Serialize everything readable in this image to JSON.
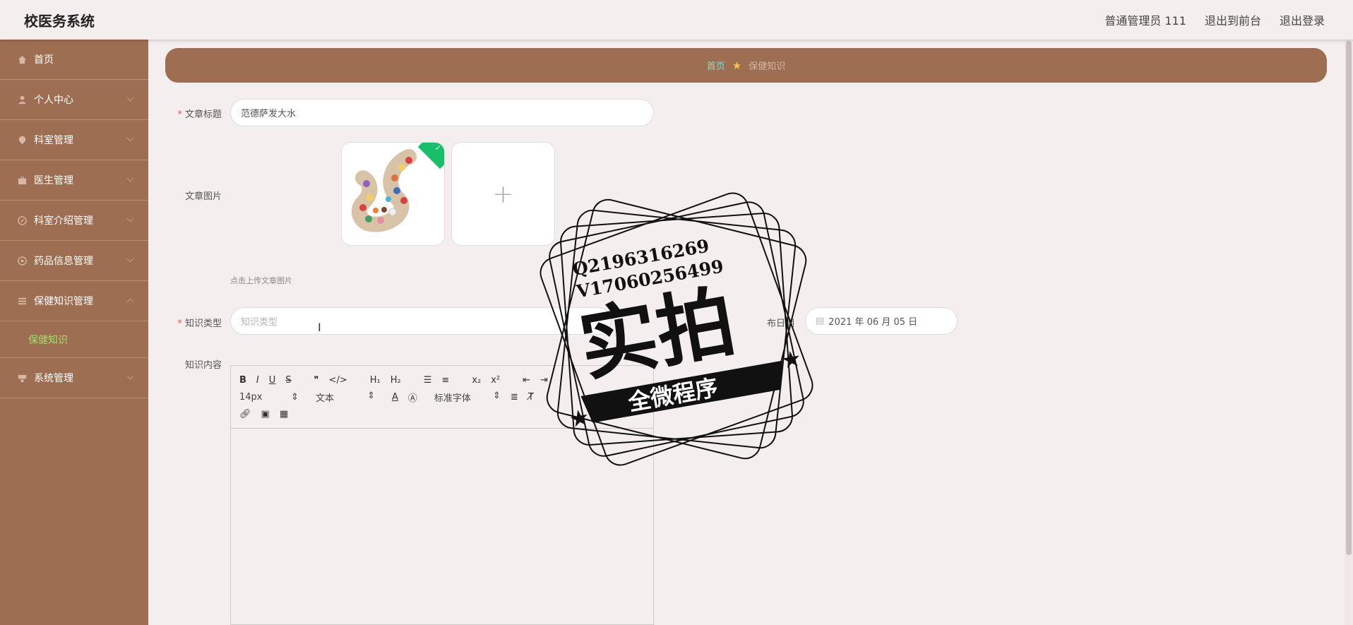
{
  "app": {
    "title": "校医务系统"
  },
  "header": {
    "user": "普通管理员 111",
    "exit_front": "退出到前台",
    "logout": "退出登录"
  },
  "sidebar": {
    "items": [
      {
        "label": "首页",
        "icon": "home-icon"
      },
      {
        "label": "个人中心",
        "icon": "user-icon"
      },
      {
        "label": "科室管理",
        "icon": "location-icon"
      },
      {
        "label": "医生管理",
        "icon": "briefcase-icon"
      },
      {
        "label": "科室介绍管理",
        "icon": "compass-icon"
      },
      {
        "label": "药品信息管理",
        "icon": "pills-icon"
      },
      {
        "label": "保健知识管理",
        "icon": "menu-icon"
      },
      {
        "label": "系统管理",
        "icon": "settings-icon"
      }
    ],
    "sub_item": "保健知识"
  },
  "breadcrumb": {
    "home": "首页",
    "current": "保健知识"
  },
  "form": {
    "title_label": "文章标题",
    "title_value": "范德萨发大水",
    "image_label": "文章图片",
    "image_hint": "点击上传文章图片",
    "type_label": "知识类型",
    "type_placeholder": "知识类型",
    "date_label": "布日期",
    "date_value": "2021 年 06 月 05 日",
    "content_label": "知识内容"
  },
  "editor": {
    "font_size": "14px",
    "header_select": "文本",
    "font_family": "标准字体"
  },
  "watermark": {
    "line1": "Q2196316269",
    "line2": "V17060256499",
    "big": "实拍",
    "ribbon": "全微程序"
  },
  "colors": {
    "sidebar": "#9e6e52",
    "accent_green": "#9be36a",
    "breadcrumb_home": "#7fe0d8"
  }
}
